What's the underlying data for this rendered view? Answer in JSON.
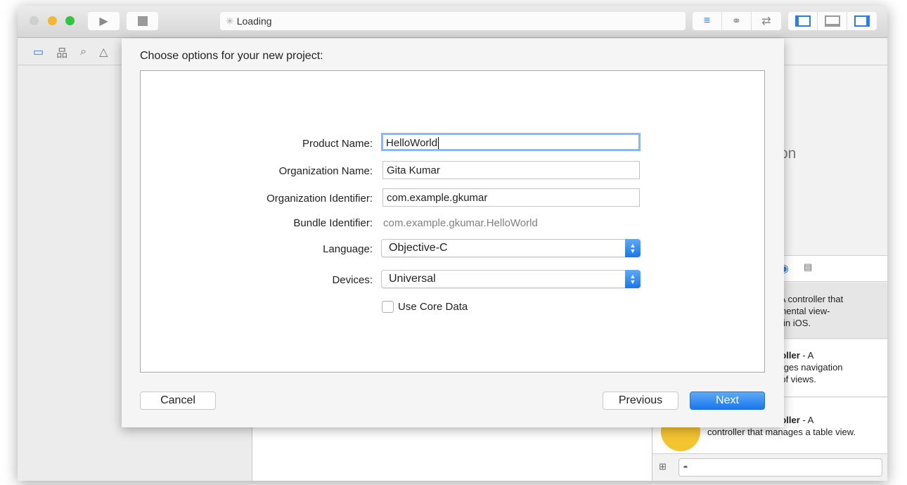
{
  "toolbar": {
    "activity_status": "Loading"
  },
  "dialog": {
    "title": "Choose options for your new project:",
    "product_name": {
      "label": "Product Name:",
      "value": "HelloWorld"
    },
    "organization_name": {
      "label": "Organization Name:",
      "value": "Gita Kumar"
    },
    "organization_identifier": {
      "label": "Organization Identifier:",
      "value": "com.example.gkumar"
    },
    "bundle_identifier": {
      "label": "Bundle Identifier:",
      "value": "com.example.gkumar.HelloWorld"
    },
    "language": {
      "label": "Language:",
      "value": "Objective-C"
    },
    "devices": {
      "label": "Devices:",
      "value": "Universal"
    },
    "use_core_data": {
      "label": "Use Core Data",
      "checked": false
    },
    "cancel": "Cancel",
    "previous": "Previous",
    "next": "Next"
  },
  "utilities": {
    "heading_fragment": "ction",
    "items": [
      {
        "title": "r",
        "desc1": " - A controller that",
        "line2": "damental view-",
        "line3": "del in iOS."
      },
      {
        "title": "ntroller",
        "desc1": " - A",
        "line2": "anages navigation",
        "line3": "hy of views."
      },
      {
        "title": "ntroller",
        "desc1": " - A",
        "line2": "controller that manages a table view."
      }
    ]
  },
  "colors": {
    "accent": "#1a78ea",
    "close": "#cfcfcf",
    "minimize": "#f5b731",
    "zoom": "#2fc540"
  }
}
